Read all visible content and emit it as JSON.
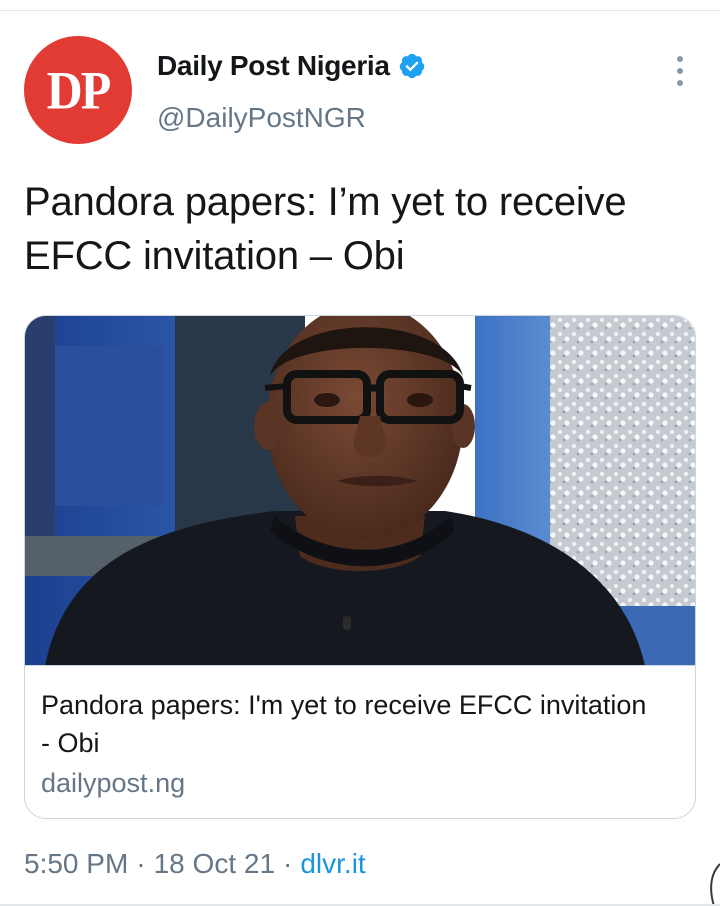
{
  "author": {
    "avatar_text": "DP",
    "display_name": "Daily Post Nigeria",
    "handle": "@DailyPostNGR",
    "verified": true,
    "brand_color": "#e23b34"
  },
  "tweet": {
    "text": "Pandora papers: I’m yet to receive EFCC invitation – Obi"
  },
  "link_card": {
    "title": "Pandora papers: I'm yet to receive EFCC invitation - Obi",
    "domain": "dailypost.ng"
  },
  "meta": {
    "time": "5:50 PM",
    "date": "18 Oct 21",
    "source": "dlvr.it",
    "separator": "·"
  },
  "colors": {
    "text": "#14171a",
    "secondary": "#657786",
    "link": "#1b95e0",
    "verified": "#1da1f2",
    "border": "#ccd6dd"
  },
  "icons": {
    "verified": "verified-badge-icon",
    "more": "more-vertical-icon"
  }
}
